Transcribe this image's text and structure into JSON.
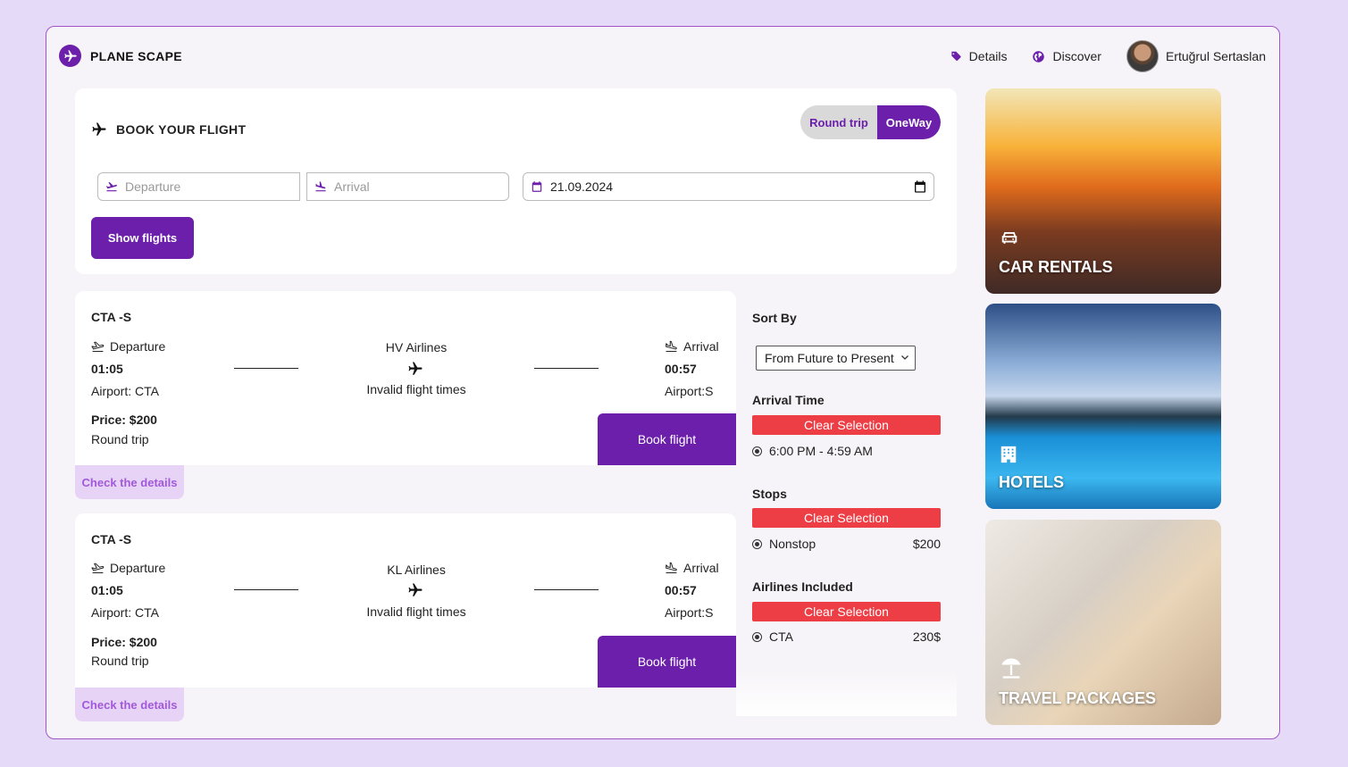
{
  "app": {
    "name": "PLANE SCAPE",
    "brand_color": "#6b1fab",
    "accent_red": "#ed3d45"
  },
  "nav": {
    "details": "Details",
    "discover": "Discover",
    "user_name": "Ertuğrul Sertaslan"
  },
  "booking": {
    "title": "BOOK YOUR FLIGHT",
    "trip_types": [
      "Round trip",
      "OneWay"
    ],
    "selected_trip_type": "OneWay",
    "departure_placeholder": "Departure",
    "arrival_placeholder": "Arrival",
    "date_value": "21.09.2024",
    "show_button": "Show flights"
  },
  "flights": [
    {
      "route": "CTA -S",
      "dep_label": "Departure",
      "dep_time": "01:05",
      "dep_airport": "Airport: CTA",
      "airline": "HV Airlines",
      "status": "Invalid flight times",
      "arr_label": "Arrival",
      "arr_time": "00:57",
      "arr_airport": "Airport:S",
      "price": "Price: $200",
      "trip": "Round trip",
      "book": "Book flight",
      "details": "Check the details"
    },
    {
      "route": "CTA -S",
      "dep_label": "Departure",
      "dep_time": "01:05",
      "dep_airport": "Airport: CTA",
      "airline": "KL Airlines",
      "status": "Invalid flight times",
      "arr_label": "Arrival",
      "arr_time": "00:57",
      "arr_airport": "Airport:S",
      "price": "Price: $200",
      "trip": "Round trip",
      "book": "Book flight",
      "details": "Check the details"
    }
  ],
  "filters": {
    "sort_label": "Sort By",
    "sort_value": "From Future to Present",
    "arrival_label": "Arrival Time",
    "arrival_clear": "Clear Selection",
    "arrival_option": "6:00 PM - 4:59 AM",
    "stops_label": "Stops",
    "stops_clear": "Clear Selection",
    "stops_option": "Nonstop",
    "stops_price": "$200",
    "airlines_label": "Airlines Included",
    "airlines_clear": "Clear Selection",
    "airlines_option": "CTA",
    "airlines_price": "230$"
  },
  "tiles": [
    {
      "label": "CAR RENTALS",
      "icon": "car-icon"
    },
    {
      "label": "HOTELS",
      "icon": "hotel-icon"
    },
    {
      "label": "TRAVEL PACKAGES",
      "icon": "beach-umbrella-icon"
    }
  ]
}
